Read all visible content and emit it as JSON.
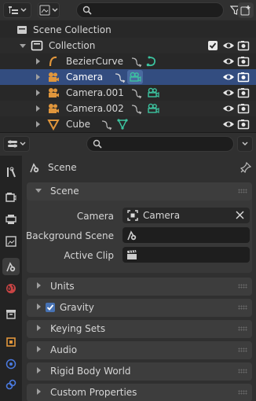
{
  "outliner": {
    "search": {
      "placeholder": ""
    },
    "rows": [
      {
        "label": "Scene Collection"
      },
      {
        "label": "Collection"
      },
      {
        "label": "BezierCurve"
      },
      {
        "label": "Camera"
      },
      {
        "label": "Camera.001"
      },
      {
        "label": "Camera.002"
      },
      {
        "label": "Cube"
      }
    ]
  },
  "properties": {
    "search": {
      "placeholder": ""
    },
    "context": {
      "label": "Scene"
    },
    "panels": {
      "scene": {
        "title": "Scene",
        "camera_label": "Camera",
        "camera_value": "Camera",
        "background_scene_label": "Background Scene",
        "active_clip_label": "Active Clip"
      },
      "units": {
        "title": "Units"
      },
      "gravity": {
        "title": "Gravity",
        "checked": true
      },
      "keying_sets": {
        "title": "Keying Sets"
      },
      "audio": {
        "title": "Audio"
      },
      "rigid_body_world": {
        "title": "Rigid Body World"
      },
      "custom_properties": {
        "title": "Custom Properties"
      }
    }
  },
  "colors": {
    "selection": "#334d80",
    "object_orange": "#e0963c",
    "data_green": "#3cc4a0",
    "accent_blue": "#4772b3"
  }
}
